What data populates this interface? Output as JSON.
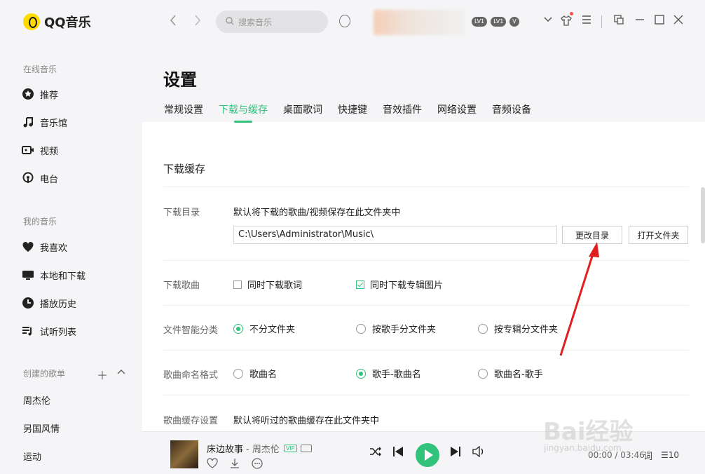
{
  "app": {
    "name": "QQ音乐"
  },
  "sidebar": {
    "online_section": "在线音乐",
    "online_items": [
      {
        "label": "推荐",
        "icon": "star-icon"
      },
      {
        "label": "音乐馆",
        "icon": "music-note-icon"
      },
      {
        "label": "视频",
        "icon": "video-icon"
      },
      {
        "label": "电台",
        "icon": "radio-icon"
      }
    ],
    "my_section": "我的音乐",
    "my_items": [
      {
        "label": "我喜欢",
        "icon": "heart-icon"
      },
      {
        "label": "本地和下载",
        "icon": "monitor-icon"
      },
      {
        "label": "播放历史",
        "icon": "clock-icon"
      },
      {
        "label": "试听列表",
        "icon": "playlist-icon"
      }
    ],
    "created_section": "创建的歌单",
    "playlists": [
      "周杰伦",
      "另国风情",
      "运动"
    ]
  },
  "topbar": {
    "search_placeholder": "搜索音乐",
    "badges": [
      "LV1",
      "LV1",
      "V"
    ]
  },
  "settings": {
    "title": "设置",
    "tabs": [
      "常规设置",
      "下载与缓存",
      "桌面歌词",
      "快捷键",
      "音效插件",
      "网络设置",
      "音频设备"
    ],
    "active_tab": "下载与缓存",
    "section_title": "下载缓存",
    "download_dir": {
      "label": "下载目录",
      "desc": "默认将下载的歌曲/视频保存在此文件夹中",
      "path": "C:\\Users\\Administrator\\Music\\",
      "change_button": "更改目录",
      "open_button": "打开文件夹"
    },
    "download_songs": {
      "label": "下载歌曲",
      "opt1": "同时下载歌词",
      "opt2": "同时下载专辑图片"
    },
    "smart_sort": {
      "label": "文件智能分类",
      "opt1": "不分文件夹",
      "opt2": "按歌手分文件夹",
      "opt3": "按专辑分文件夹"
    },
    "naming": {
      "label": "歌曲命名格式",
      "opt1": "歌曲名",
      "opt2": "歌手-歌曲名",
      "opt3": "歌曲名-歌手"
    },
    "cache": {
      "label": "歌曲缓存设置",
      "desc": "默认将听过的歌曲缓存在此文件夹中"
    }
  },
  "player": {
    "song": "床边故事",
    "artist": "- 周杰伦",
    "vip": "VIP",
    "time": "00:00 / 03:46",
    "lyric": "词",
    "count": "10"
  },
  "watermark": {
    "text": "Bai经验",
    "sub": "jingyan.baidu.com"
  }
}
